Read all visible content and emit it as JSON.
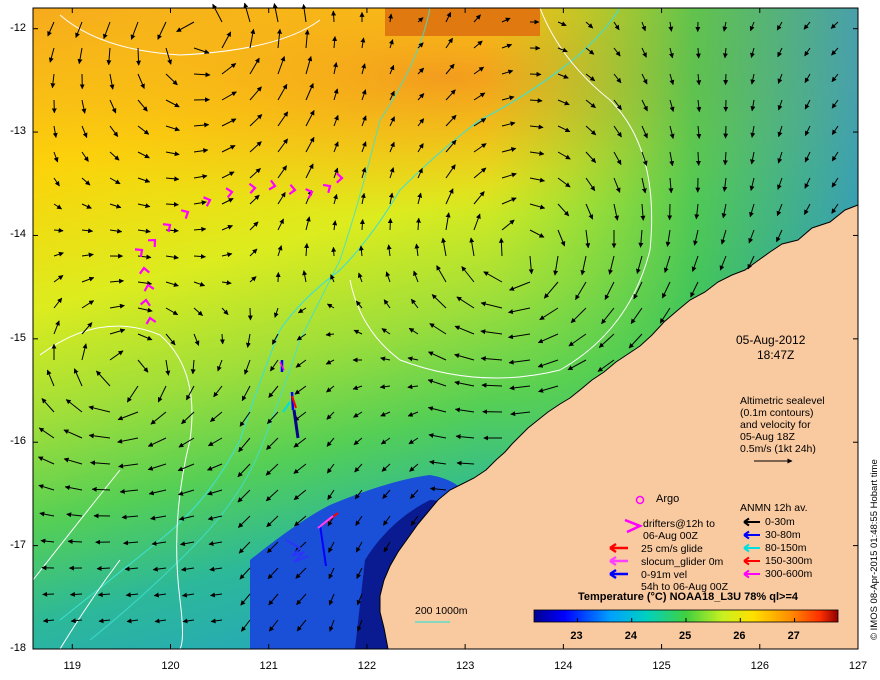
{
  "map": {
    "lat_ticks": [
      "-12",
      "-13",
      "-14",
      "-15",
      "-16",
      "-17",
      "-18"
    ],
    "lon_ticks": [
      "119",
      "120",
      "121",
      "122",
      "123",
      "124",
      "125",
      "126",
      "127"
    ],
    "lat_range": [
      -18,
      -11.8
    ],
    "lon_range": [
      118.6,
      127
    ],
    "land_color": "#f9c9a0",
    "contour_color": "#ffffff",
    "bathy_color": "#40e0d0"
  },
  "annotations": {
    "date": "05-Aug-2012",
    "time": "18:47Z",
    "altimetry_lines": [
      "Altimetric sealevel",
      "(0.1m contours)",
      "and velocity for",
      "05-Aug 18Z",
      "0.5m/s (1kt 24h)"
    ]
  },
  "legend": {
    "argo": "Argo",
    "drifters": [
      "drifters@12h to",
      "06-Aug 00Z"
    ],
    "glide": "25 cm/s glide",
    "slocum": "slocum_glider 0m",
    "vel": [
      "0-91m vel",
      "54h to 06-Aug 00Z"
    ],
    "anmn_title": "ANMN 12h av.",
    "anmn_items": [
      {
        "label": "0-30m",
        "color": "#000000"
      },
      {
        "label": "30-80m",
        "color": "#0000ff"
      },
      {
        "label": "80-150m",
        "color": "#00e0e0"
      },
      {
        "label": "150-300m",
        "color": "#ff0000"
      },
      {
        "label": "300-600m",
        "color": "#ff00ff"
      }
    ],
    "depth_label": "200  1000m",
    "colors": {
      "argo": "#ff00ff",
      "drifter": "#ff00ff",
      "glide": "#ff0000",
      "slocum": "#ff40ff",
      "vel": "#0000ff"
    }
  },
  "colorbar": {
    "title": "Temperature (°C) NOAA18_L3U 78% ql>=4",
    "ticks": [
      "23",
      "24",
      "25",
      "26",
      "27"
    ],
    "range": [
      22.2,
      27.8
    ],
    "tick_values": [
      23,
      24,
      25,
      26,
      27
    ]
  },
  "credit": "© IMOS 08-Apr-2015 01:48:55 Hobart time"
}
